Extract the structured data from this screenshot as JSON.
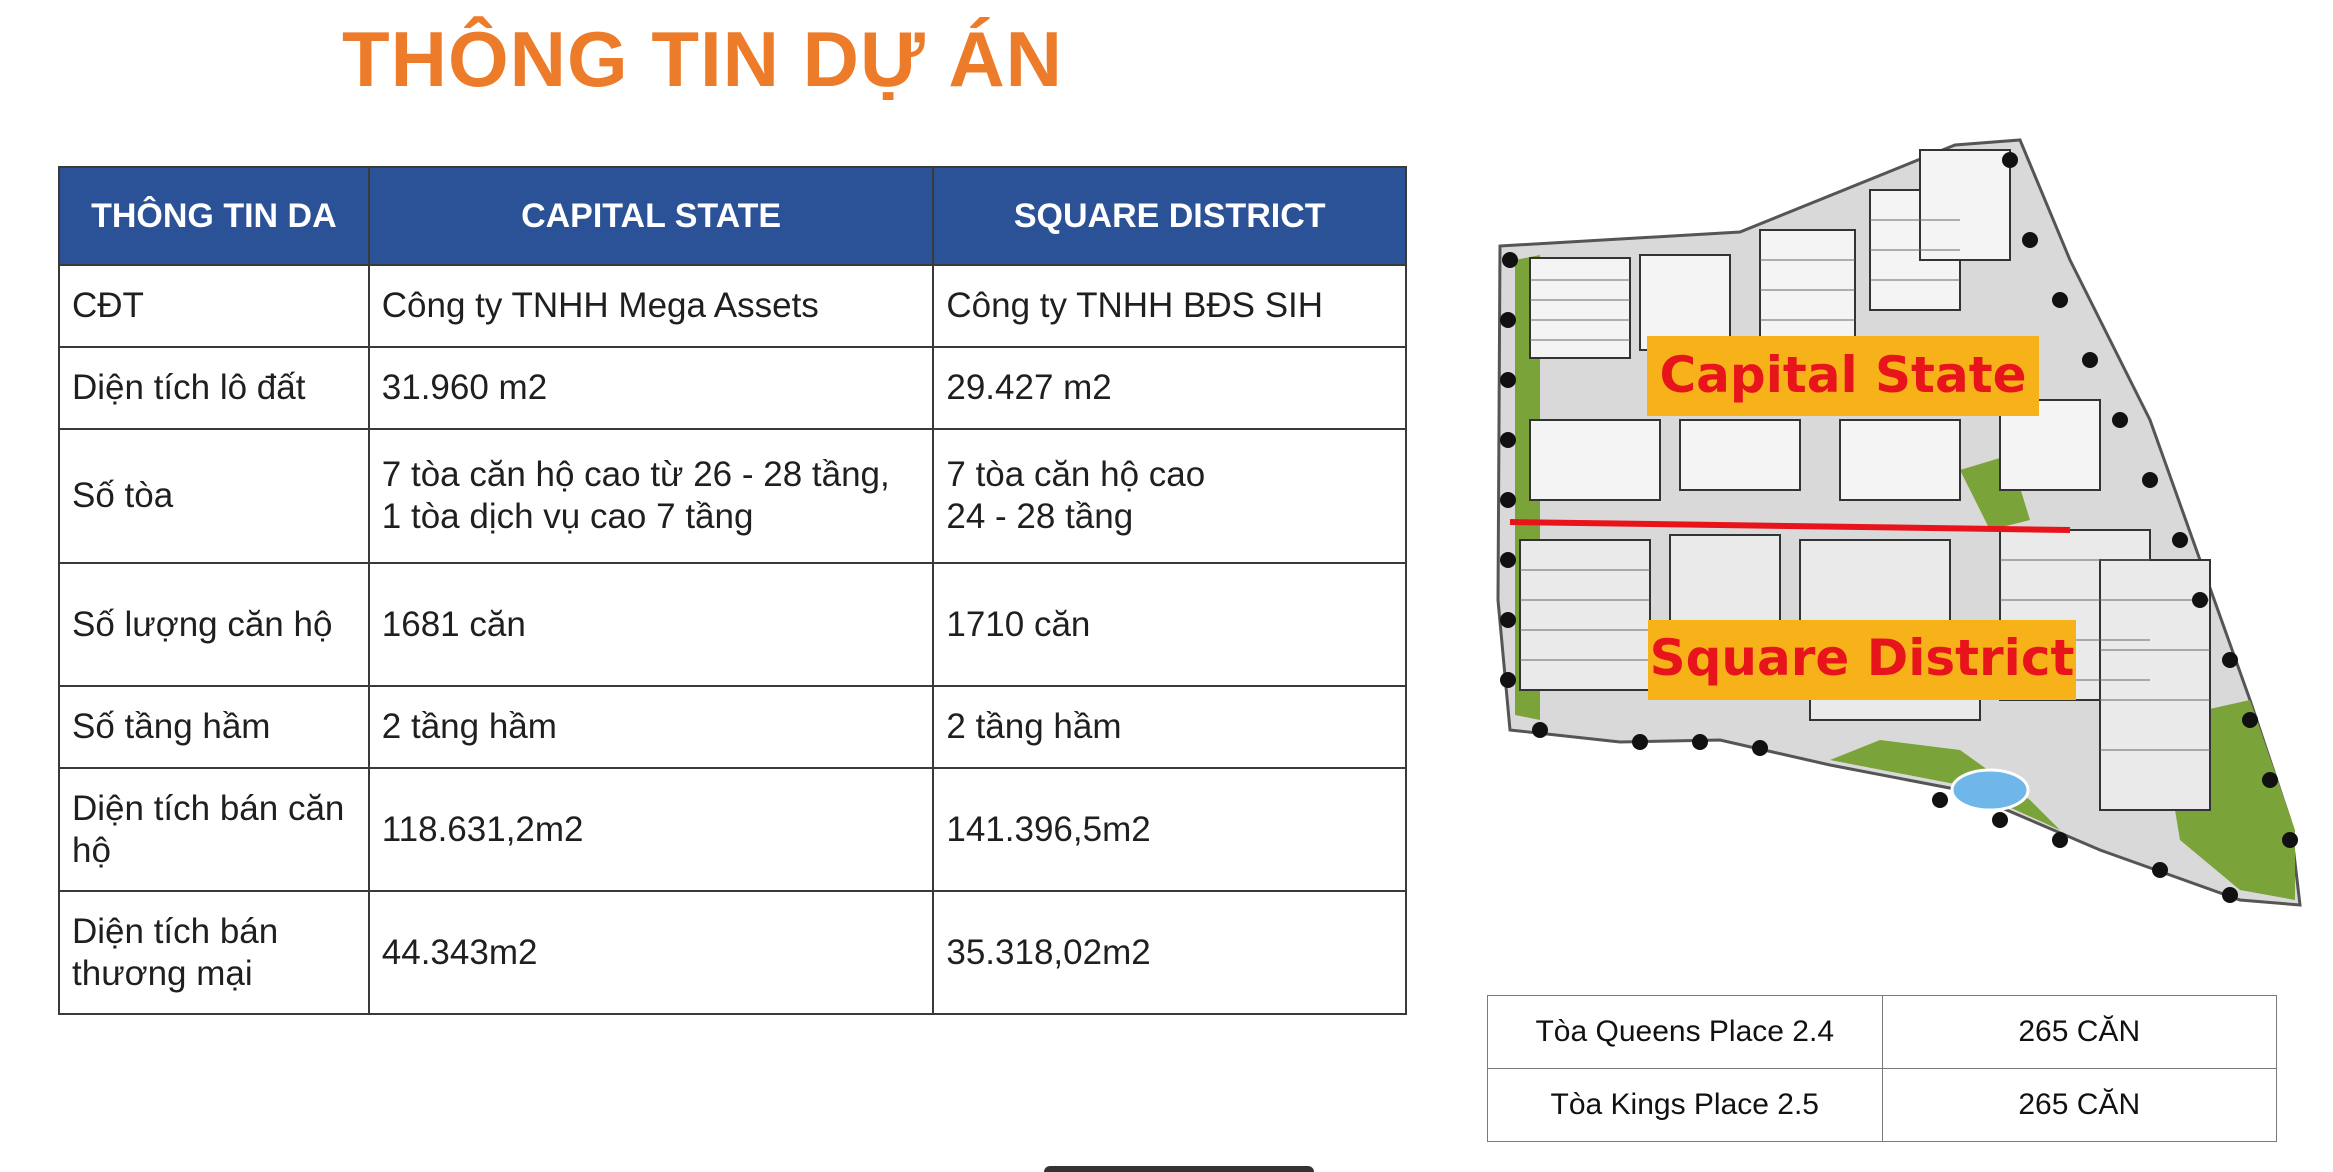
{
  "title": "THÔNG TIN DỰ ÁN",
  "table": {
    "headers": [
      "THÔNG TIN DA",
      "CAPITAL STATE",
      "SQUARE DISTRICT"
    ],
    "rows": [
      [
        "CĐT",
        "Công ty TNHH Mega Assets",
        "Công ty TNHH BĐS SIH"
      ],
      [
        "Diện tích lô đất",
        "31.960 m2",
        "29.427 m2"
      ],
      [
        "Số tòa",
        "7 tòa căn hộ cao từ 26 - 28 tầng,\n1 tòa dịch vụ cao 7 tầng",
        "7 tòa căn hộ cao\n24 - 28 tầng"
      ],
      [
        "Số lượng căn hộ",
        "1681 căn",
        "1710 căn"
      ],
      [
        "Số tầng hầm",
        "2 tầng hầm",
        "2 tầng hầm"
      ],
      [
        "Diện tích bán căn\nhộ",
        "118.631,2m2",
        "141.396,5m2"
      ],
      [
        "Diện tích bán\nthương mại",
        "44.343m2",
        "35.318,02m2"
      ]
    ]
  },
  "map": {
    "label_top": "Capital State",
    "label_bottom": "Square District",
    "label_color": "#e8141c",
    "label_bg": "#f7b21a",
    "divider_color": "#e8141c"
  },
  "units_table": [
    [
      "Tòa Queens Place 2.4",
      "265 CĂN"
    ],
    [
      "Tòa Kings Place 2.5",
      "265 CĂN"
    ]
  ]
}
